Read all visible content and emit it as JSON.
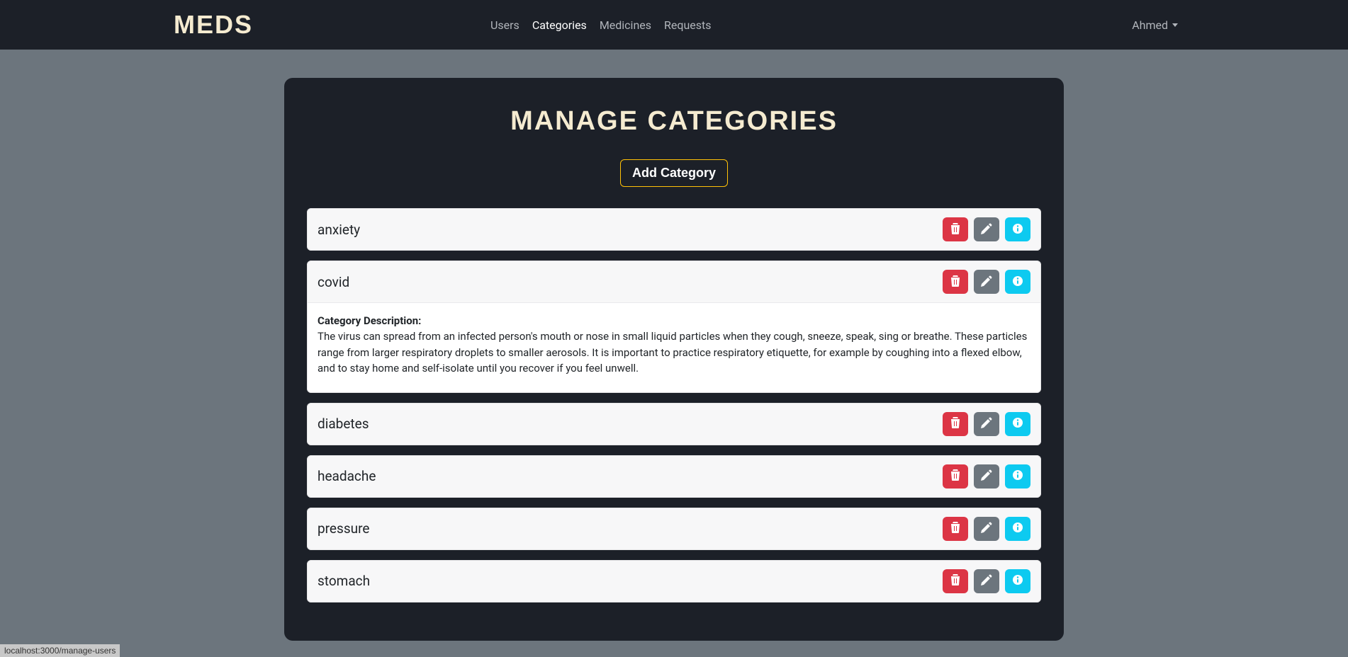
{
  "navbar": {
    "brand": "MEDS",
    "links": [
      "Users",
      "Categories",
      "Medicines",
      "Requests"
    ],
    "active_index": 1,
    "user_name": "Ahmed"
  },
  "page": {
    "title": "MANAGE CATEGORIES",
    "add_button": "Add Category",
    "description_label": "Category Description:"
  },
  "categories": [
    {
      "name": "anxiety",
      "expanded": false,
      "description": ""
    },
    {
      "name": "covid",
      "expanded": true,
      "description": "The virus can spread from an infected person's mouth or nose in small liquid particles when they cough, sneeze, speak, sing or breathe. These particles range from larger respiratory droplets to smaller aerosols. It is important to practice respiratory etiquette, for example by coughing into a flexed elbow, and to stay home and self-isolate until you recover if you feel unwell."
    },
    {
      "name": "diabetes",
      "expanded": false,
      "description": ""
    },
    {
      "name": "headache",
      "expanded": false,
      "description": ""
    },
    {
      "name": "pressure",
      "expanded": false,
      "description": ""
    },
    {
      "name": "stomach",
      "expanded": false,
      "description": ""
    }
  ],
  "status_bar": "localhost:3000/manage-users"
}
